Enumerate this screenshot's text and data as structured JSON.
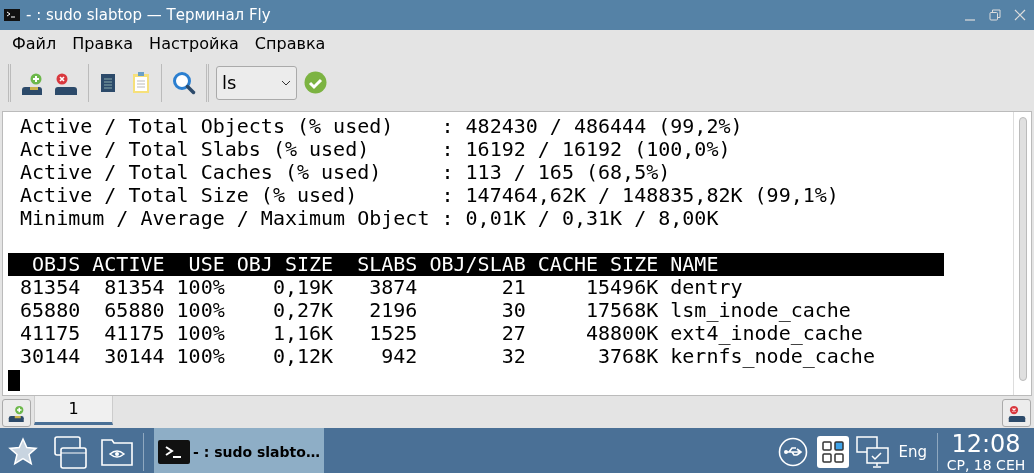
{
  "window": {
    "title": "- : sudo slabtop — Терминал Fly"
  },
  "menu": [
    {
      "label": "Файл"
    },
    {
      "label": "Правка"
    },
    {
      "label": "Настройка"
    },
    {
      "label": "Справка"
    }
  ],
  "toolbar": {
    "command_combo": {
      "value": "ls"
    }
  },
  "terminal": {
    "summary_lines": [
      " Active / Total Objects (% used)    : 482430 / 486444 (99,2%)",
      " Active / Total Slabs (% used)      : 16192 / 16192 (100,0%)",
      " Active / Total Caches (% used)     : 113 / 165 (68,5%)",
      " Active / Total Size (% used)       : 147464,62K / 148835,82K (99,1%)",
      " Minimum / Average / Maximum Object : 0,01K / 0,31K / 8,00K"
    ],
    "header_line": "  OBJS ACTIVE  USE OBJ SIZE  SLABS OBJ/SLAB CACHE SIZE NAME",
    "rows": [
      " 81354  81354 100%    0,19K   3874       21     15496K dentry",
      " 65880  65880 100%    0,27K   2196       30     17568K lsm_inode_cache",
      " 41175  41175 100%    1,16K   1525       27     48800K ext4_inode_cache",
      " 30144  30144 100%    0,12K    942       32      3768K kernfs_node_cache"
    ]
  },
  "tabs": [
    {
      "label": "1",
      "selected": true
    }
  ],
  "taskbar": {
    "tasks": [
      {
        "label": "- : sudo slabto…",
        "selected": true
      }
    ],
    "language": "Eng",
    "clock": {
      "time": "12:08",
      "date": "СР, 18 СЕН"
    }
  }
}
